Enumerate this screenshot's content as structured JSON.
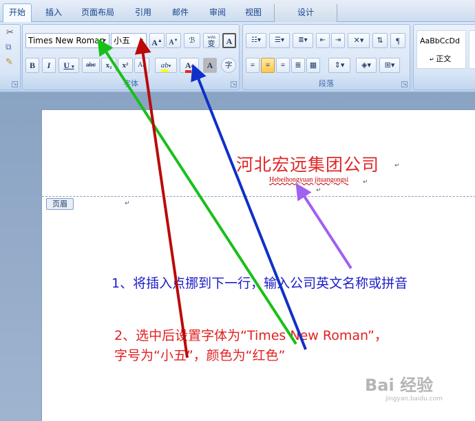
{
  "tabs": [
    {
      "label": "开始",
      "active": true
    },
    {
      "label": "插入",
      "active": false
    },
    {
      "label": "页面布局",
      "active": false
    },
    {
      "label": "引用",
      "active": false
    },
    {
      "label": "邮件",
      "active": false
    },
    {
      "label": "审阅",
      "active": false
    },
    {
      "label": "视图",
      "active": false
    },
    {
      "label": "设计",
      "active": false
    }
  ],
  "font_group": {
    "label": "字体",
    "font_name": "Times New Roman",
    "font_size": "小五",
    "grow_label": "A",
    "shrink_label": "A",
    "phonetic_label": "wén",
    "phonetic_char": "变",
    "border_char": "A",
    "bold": "B",
    "italic": "I",
    "underline": "U",
    "strike": "abc",
    "subscript": "x₂",
    "superscript": "x²",
    "clear_format": "Aa",
    "highlight": "ab",
    "font_color_char": "A",
    "shade_char": "A",
    "enclose_char": "字"
  },
  "paragraph_group": {
    "label": "段落"
  },
  "styles_group": {
    "style_preview": "AaBbCcDd",
    "style_name": "正文"
  },
  "colors": {
    "highlight": "#ffff00",
    "font_color": "#e02727",
    "green_arrow": "#18c018",
    "red_arrow": "#bb0a0a",
    "blue_arrow": "#1030c8",
    "purple_arrow": "#a060f0"
  },
  "document": {
    "company_cn": "河北宏远集团公司",
    "company_en": "Hebeihongyuan jituangongsi",
    "header_tag": "页眉",
    "pilcrow": "↵"
  },
  "notes": {
    "note1": "1、将插入点挪到下一行，输入公司英文名称或拼音",
    "note2_line1": "2、选中后设置字体为“Times New Roman”，",
    "note2_line2": "字号为“小五”，颜色为“红色”"
  },
  "watermark": {
    "logo": "Bai 经验",
    "url": "jingyan.baidu.com"
  }
}
